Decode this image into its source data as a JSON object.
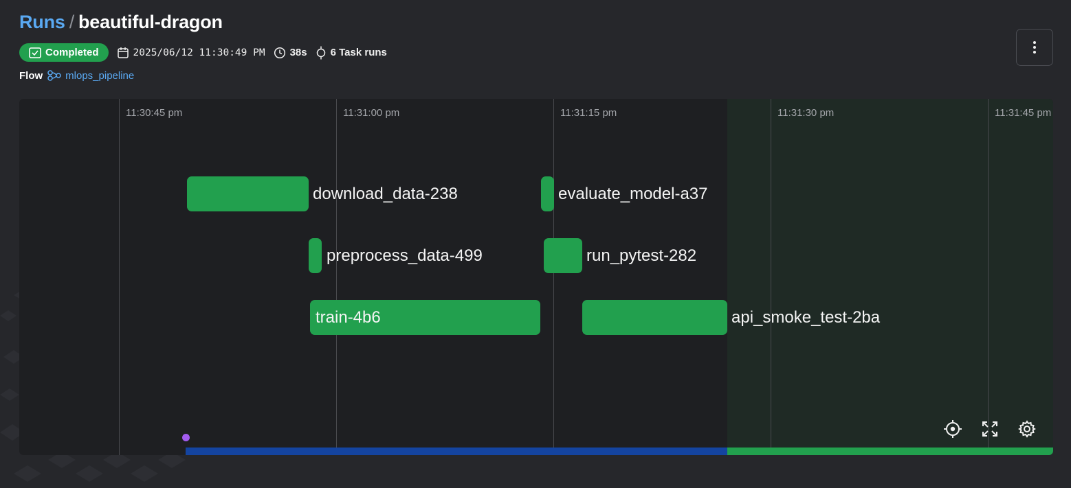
{
  "breadcrumb": {
    "parent": "Runs",
    "separator": "/",
    "current": "beautiful-dragon"
  },
  "status": {
    "label": "Completed",
    "color": "#22a04e"
  },
  "meta": {
    "date": "2025/06/12 11:30:49 PM",
    "duration": "38s",
    "task_runs": "6 Task runs"
  },
  "flow": {
    "label": "Flow",
    "name": "mlops_pipeline"
  },
  "timeline": {
    "ticks": [
      "11:30:45 pm",
      "11:31:00 pm",
      "11:31:15 pm",
      "11:31:30 pm",
      "11:31:45 pm"
    ],
    "tasks": [
      {
        "name": "download_data-238"
      },
      {
        "name": "preprocess_data-499"
      },
      {
        "name": "train-4b6"
      },
      {
        "name": "evaluate_model-a37"
      },
      {
        "name": "run_pytest-282"
      },
      {
        "name": "api_smoke_test-2ba"
      }
    ]
  },
  "icons": {
    "menu": "vertical-ellipsis-icon",
    "completed": "check-square-icon",
    "calendar": "calendar-icon",
    "duration": "clock-icon",
    "task_runs": "task-node-icon",
    "flow": "flow-icon",
    "recenter": "crosshair-icon",
    "fullscreen": "expand-icon",
    "settings": "gear-icon"
  },
  "colors": {
    "accent": "#5aa9f2",
    "success": "#22a04e",
    "progress": "#1444a0",
    "start_marker": "#a35cf0"
  }
}
